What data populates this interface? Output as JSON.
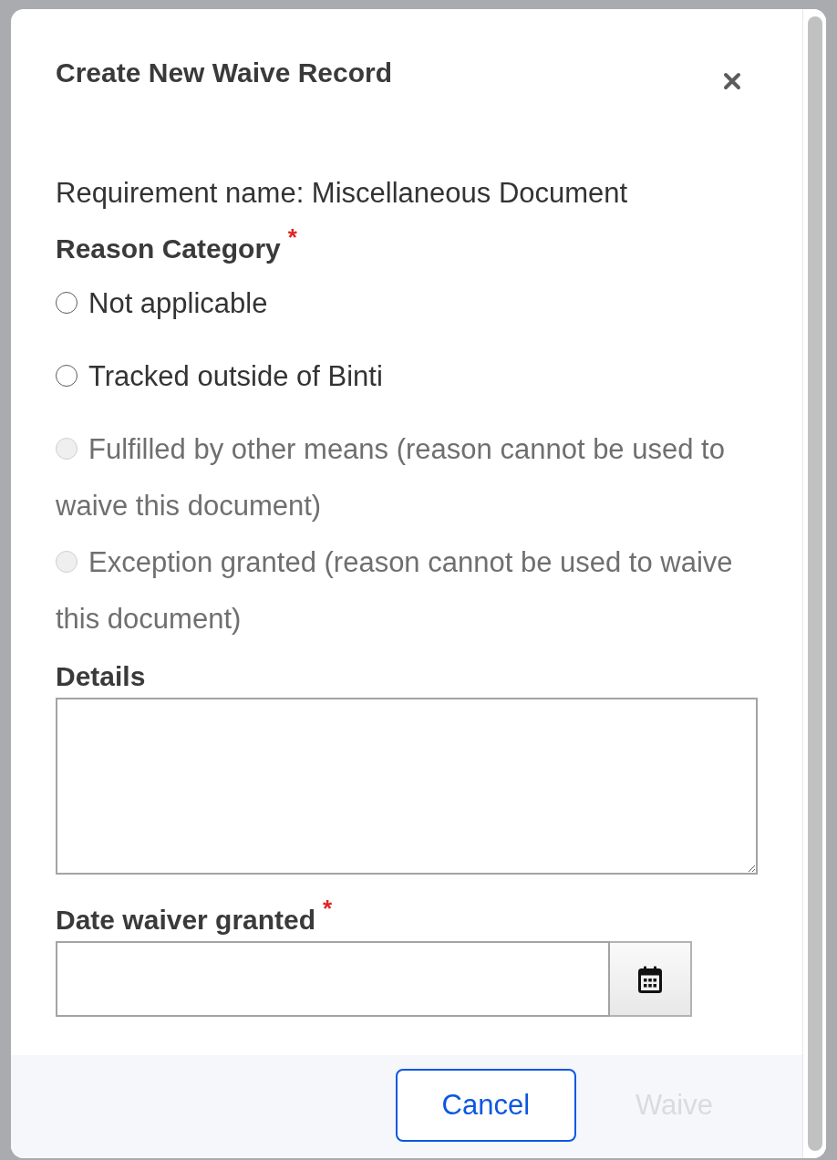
{
  "dialog": {
    "title": "Create New Waive Record"
  },
  "requirement": "Requirement name: Miscellaneous Document",
  "reason_category": {
    "label": "Reason Category",
    "required_mark": "*",
    "options": [
      {
        "label": "Not applicable",
        "selected": false,
        "disabled": false
      },
      {
        "label": "Tracked outside of Binti",
        "selected": false,
        "disabled": false
      },
      {
        "label": "Fulfilled by other means (reason cannot be used to waive this document)",
        "selected": false,
        "disabled": true
      },
      {
        "label": "Exception granted (reason cannot be used to waive this document)",
        "selected": false,
        "disabled": true
      }
    ]
  },
  "details": {
    "label": "Details"
  },
  "date_waiver_granted": {
    "label": "Date waiver granted",
    "required_mark": "*"
  },
  "buttons": [
    {
      "label": "Cancel",
      "kind": "outline",
      "disabled": false
    },
    {
      "label": "Waive",
      "kind": "primary",
      "disabled": true
    }
  ]
}
